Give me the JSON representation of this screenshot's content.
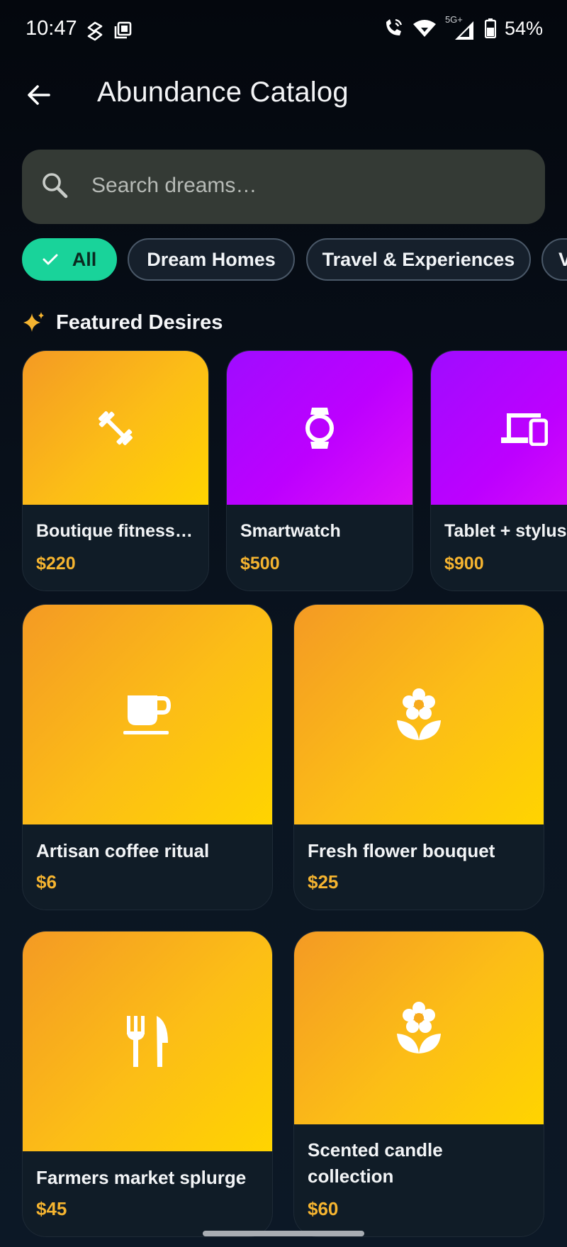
{
  "status_bar": {
    "time": "10:47",
    "network_label": "5G+",
    "battery": "54%"
  },
  "app_bar": {
    "title": "Abundance Catalog"
  },
  "search": {
    "placeholder": "Search dreams…"
  },
  "filters": [
    {
      "label": "All",
      "selected": true
    },
    {
      "label": "Dream Homes",
      "selected": false
    },
    {
      "label": "Travel & Experiences",
      "selected": false
    },
    {
      "label": "V",
      "selected": false
    }
  ],
  "featured": {
    "title": "Featured Desires",
    "items": [
      {
        "name": "Boutique fitness…",
        "price": "$220",
        "icon": "dumbbell-icon",
        "color": "orange"
      },
      {
        "name": "Smartwatch",
        "price": "$500",
        "icon": "watch-icon",
        "color": "purple"
      },
      {
        "name": "Tablet + stylus",
        "price": "$900",
        "icon": "devices-icon",
        "color": "purple"
      }
    ]
  },
  "grid": [
    {
      "name": "Artisan coffee ritual",
      "price": "$6",
      "icon": "coffee-cup-icon"
    },
    {
      "name": "Fresh flower bouquet",
      "price": "$25",
      "icon": "flower-icon"
    },
    {
      "name": "Farmers market splurge",
      "price": "$45",
      "icon": "restaurant-icon"
    },
    {
      "name": "Scented candle collection",
      "price": "$60",
      "icon": "flower-icon"
    }
  ],
  "colors": {
    "accent_chip": "#19d39a",
    "price": "#f5b430",
    "orange_start": "#f49a24",
    "orange_end": "#ffd400",
    "purple_start": "#9f0cff",
    "purple_end": "#de10f6"
  }
}
